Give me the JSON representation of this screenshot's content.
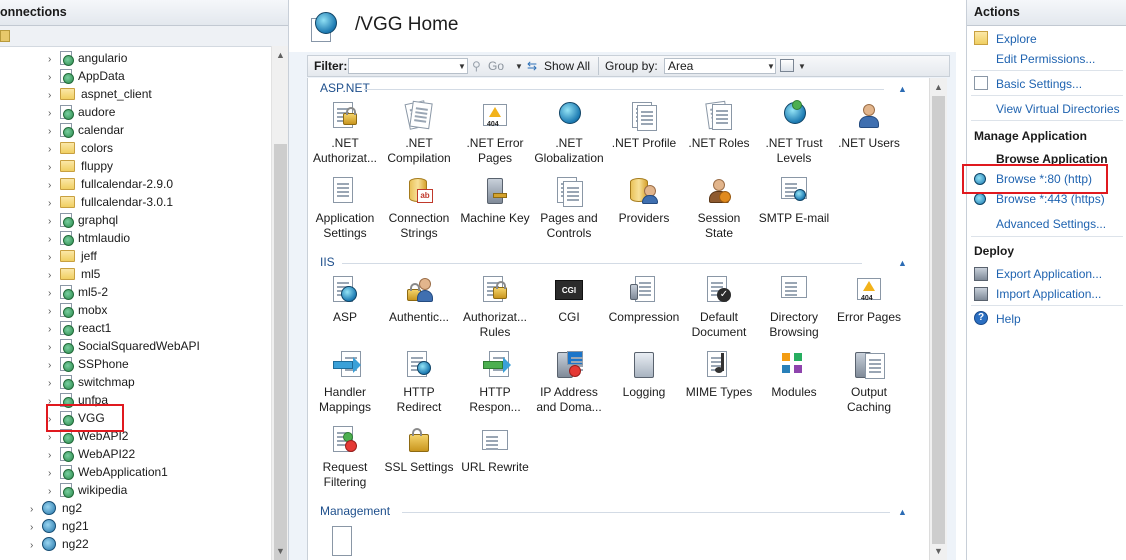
{
  "connections": {
    "title": "onnections",
    "tree": [
      {
        "label": "angulario",
        "icon": "globe-doc-icon"
      },
      {
        "label": "AppData",
        "icon": "globe-doc-icon"
      },
      {
        "label": "aspnet_client",
        "icon": "folder-icon"
      },
      {
        "label": "audore",
        "icon": "globe-doc-icon"
      },
      {
        "label": "calendar",
        "icon": "globe-doc-icon"
      },
      {
        "label": "colors",
        "icon": "folder-icon"
      },
      {
        "label": "fluppy",
        "icon": "folder-icon"
      },
      {
        "label": "fullcalendar-2.9.0",
        "icon": "folder-icon"
      },
      {
        "label": "fullcalendar-3.0.1",
        "icon": "folder-icon"
      },
      {
        "label": "graphql",
        "icon": "globe-doc-icon"
      },
      {
        "label": "htmlaudio",
        "icon": "globe-doc-icon"
      },
      {
        "label": "jeff",
        "icon": "folder-icon"
      },
      {
        "label": "ml5",
        "icon": "folder-icon"
      },
      {
        "label": "ml5-2",
        "icon": "globe-doc-icon"
      },
      {
        "label": "mobx",
        "icon": "globe-doc-icon"
      },
      {
        "label": "react1",
        "icon": "globe-doc-icon"
      },
      {
        "label": "SocialSquaredWebAPI",
        "icon": "globe-doc-icon"
      },
      {
        "label": "SSPhone",
        "icon": "globe-doc-icon"
      },
      {
        "label": "switchmap",
        "icon": "globe-doc-icon"
      },
      {
        "label": "unfpa",
        "icon": "globe-doc-icon"
      },
      {
        "label": "VGG",
        "icon": "globe-doc-icon"
      },
      {
        "label": "WebAPI2",
        "icon": "globe-doc-icon"
      },
      {
        "label": "WebAPI22",
        "icon": "globe-doc-icon"
      },
      {
        "label": "WebApplication1",
        "icon": "globe-doc-icon"
      },
      {
        "label": "wikipedia",
        "icon": "globe-doc-icon"
      }
    ],
    "sites": [
      {
        "label": "ng2",
        "icon": "server-globe-icon"
      },
      {
        "label": "ng21",
        "icon": "server-globe-icon"
      },
      {
        "label": "ng22",
        "icon": "server-globe-icon"
      }
    ]
  },
  "home": {
    "title": "/VGG Home",
    "filter_label": "Filter:",
    "go_label": "Go",
    "show_all_label": "Show All",
    "group_by_label": "Group by:",
    "group_by_value": "Area"
  },
  "sections": {
    "aspnet": {
      "title": "ASP.NET",
      "features": [
        {
          "label": ".NET Authorizat...",
          "icon": "lock-doc-icon"
        },
        {
          "label": ".NET Compilation",
          "icon": "stack-icon"
        },
        {
          "label": ".NET Error Pages",
          "icon": "error-404-icon"
        },
        {
          "label": ".NET Globalization",
          "icon": "globe-icon"
        },
        {
          "label": ".NET Profile",
          "icon": "profile-doc-icon"
        },
        {
          "label": ".NET Roles",
          "icon": "roles-doc-icon"
        },
        {
          "label": ".NET Trust Levels",
          "icon": "trust-globe-icon"
        },
        {
          "label": ".NET Users",
          "icon": "users-icon"
        },
        {
          "label": "Application Settings",
          "icon": "settings-list-icon"
        },
        {
          "label": "Connection Strings",
          "icon": "database-icon"
        },
        {
          "label": "Machine Key",
          "icon": "machine-key-icon"
        },
        {
          "label": "Pages and Controls",
          "icon": "pages-controls-icon"
        },
        {
          "label": "Providers",
          "icon": "providers-icon"
        },
        {
          "label": "Session State",
          "icon": "session-state-icon"
        },
        {
          "label": "SMTP E-mail",
          "icon": "smtp-email-icon"
        }
      ]
    },
    "iis": {
      "title": "IIS",
      "features": [
        {
          "label": "ASP",
          "icon": "asp-icon"
        },
        {
          "label": "Authentic...",
          "icon": "authentication-icon"
        },
        {
          "label": "Authorizat... Rules",
          "icon": "authorization-rules-icon"
        },
        {
          "label": "CGI",
          "icon": "cgi-icon"
        },
        {
          "label": "Compression",
          "icon": "compression-icon"
        },
        {
          "label": "Default Document",
          "icon": "default-document-icon"
        },
        {
          "label": "Directory Browsing",
          "icon": "directory-browsing-icon"
        },
        {
          "label": "Error Pages",
          "icon": "error-404-icon"
        },
        {
          "label": "Handler Mappings",
          "icon": "handler-mappings-icon"
        },
        {
          "label": "HTTP Redirect",
          "icon": "http-redirect-icon"
        },
        {
          "label": "HTTP Respon...",
          "icon": "http-response-icon"
        },
        {
          "label": "IP Address and Doma...",
          "icon": "ip-address-icon"
        },
        {
          "label": "Logging",
          "icon": "logging-icon"
        },
        {
          "label": "MIME Types",
          "icon": "mime-types-icon"
        },
        {
          "label": "Modules",
          "icon": "modules-icon"
        },
        {
          "label": "Output Caching",
          "icon": "output-caching-icon"
        },
        {
          "label": "Request Filtering",
          "icon": "request-filtering-icon"
        },
        {
          "label": "SSL Settings",
          "icon": "ssl-lock-icon"
        },
        {
          "label": "URL Rewrite",
          "icon": "url-rewrite-icon"
        }
      ]
    },
    "management": {
      "title": "Management"
    }
  },
  "actions": {
    "title": "Actions",
    "explore": "Explore",
    "edit_permissions": "Edit Permissions...",
    "basic_settings": "Basic Settings...",
    "view_virtual_directories": "View Virtual Directories",
    "manage_application": "Manage Application",
    "browse_application": "Browse Application",
    "browse_80": "Browse *:80 (http)",
    "browse_443": "Browse *:443 (https)",
    "advanced_settings": "Advanced Settings...",
    "deploy": "Deploy",
    "export_application": "Export Application...",
    "import_application": "Import Application...",
    "help": "Help"
  },
  "colors": {
    "link_blue": "#1f63b0",
    "section_blue": "#1e4f8c",
    "highlight_red": "#e0191f"
  }
}
